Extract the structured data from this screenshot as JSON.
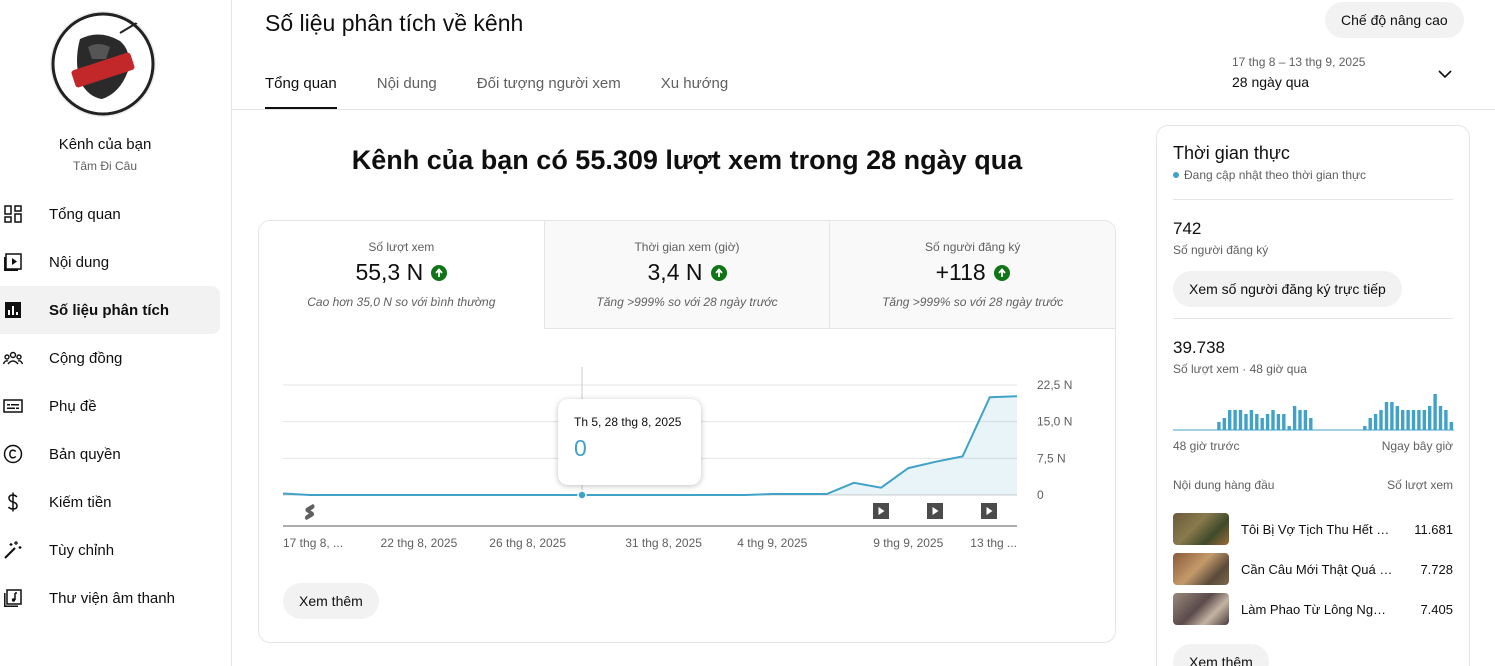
{
  "sidebar": {
    "channel_title": "Kênh của bạn",
    "channel_name": "Tâm Đi Câu",
    "items": [
      {
        "label": "Tổng quan",
        "icon": "dashboard-icon"
      },
      {
        "label": "Nội dung",
        "icon": "content-icon"
      },
      {
        "label": "Số liệu phân tích",
        "icon": "analytics-icon",
        "active": true
      },
      {
        "label": "Cộng đồng",
        "icon": "community-icon"
      },
      {
        "label": "Phụ đề",
        "icon": "subtitles-icon"
      },
      {
        "label": "Bản quyền",
        "icon": "copyright-icon"
      },
      {
        "label": "Kiếm tiền",
        "icon": "dollar-icon"
      },
      {
        "label": "Tùy chỉnh",
        "icon": "magic-wand-icon"
      },
      {
        "label": "Thư viện âm thanh",
        "icon": "audio-library-icon"
      }
    ]
  },
  "header": {
    "title": "Số liệu phân tích về kênh",
    "advanced_mode": "Chế độ nâng cao",
    "tabs": [
      "Tổng quan",
      "Nội dung",
      "Đối tượng người xem",
      "Xu hướng"
    ],
    "date_range": "17 thg 8 – 13 thg 9, 2025",
    "date_label": "28 ngày qua"
  },
  "main": {
    "headline": "Kênh của bạn có 55.309 lượt xem trong 28 ngày qua",
    "metrics": [
      {
        "label": "Số lượt xem",
        "value": "55,3 N",
        "sub": "Cao hơn 35,0 N so với bình thường"
      },
      {
        "label": "Thời gian xem (giờ)",
        "value": "3,4 N",
        "sub": "Tăng >999% so với 28 ngày trước"
      },
      {
        "label": "Số người đăng ký",
        "value": "+118",
        "sub": "Tăng >999% so với 28 ngày trước"
      }
    ],
    "tooltip": {
      "date": "Th 5, 28 thg 8, 2025",
      "value": "0"
    },
    "see_more": "Xem thêm"
  },
  "chart_data": {
    "type": "area",
    "x": [
      "17 thg 8",
      "18 thg 8",
      "19 thg 8",
      "20 thg 8",
      "21 thg 8",
      "22 thg 8",
      "23 thg 8",
      "24 thg 8",
      "25 thg 8",
      "26 thg 8",
      "27 thg 8",
      "28 thg 8",
      "29 thg 8",
      "30 thg 8",
      "31 thg 8",
      "1 thg 9",
      "2 thg 9",
      "3 thg 9",
      "4 thg 9",
      "5 thg 9",
      "6 thg 9",
      "7 thg 9",
      "8 thg 9",
      "9 thg 9",
      "10 thg 9",
      "11 thg 9",
      "12 thg 9",
      "13 thg 9"
    ],
    "values": [
      300,
      0,
      0,
      0,
      0,
      0,
      0,
      0,
      0,
      0,
      0,
      0,
      0,
      0,
      0,
      0,
      0,
      0,
      200,
      200,
      200,
      2500,
      1500,
      5500,
      6800,
      7900,
      20000,
      20200
    ],
    "x_tick_labels": [
      "17 thg 8, ...",
      "22 thg 8, 2025",
      "26 thg 8, 2025",
      "31 thg 8, 2025",
      "4 thg 9, 2025",
      "9 thg 9, 2025",
      "13 thg ..."
    ],
    "y_tick_labels": [
      "22,5 N",
      "15,0 N",
      "7,5 N",
      "0"
    ],
    "ylim": [
      0,
      22500
    ],
    "line_color": "#41a2c7"
  },
  "realtime": {
    "title": "Thời gian thực",
    "live_label": "Đang cập nhật theo thời gian thực",
    "subs_value": "742",
    "subs_caption": "Số người đăng ký",
    "subs_button": "Xem số người đăng ký trực tiếp",
    "views_value": "39.738",
    "views_caption": "Số lượt xem · 48 giờ qua",
    "spark_left": "48 giờ trước",
    "spark_right": "Ngay bây giờ",
    "spark_values": [
      0,
      0,
      0,
      0,
      0,
      0,
      0,
      0,
      2,
      3,
      5,
      5,
      5,
      4,
      5,
      4,
      3,
      4,
      5,
      4,
      4,
      1,
      6,
      5,
      5,
      3,
      0,
      0,
      0,
      0,
      0,
      0,
      0,
      0,
      0,
      1,
      3,
      4,
      5,
      7,
      7,
      6,
      5,
      5,
      5,
      5,
      5,
      6,
      9,
      6,
      5,
      2
    ],
    "top_header_left": "Nội dung hàng đầu",
    "top_header_right": "Số lượt xem",
    "top_items": [
      {
        "title": "Tôi Bị Vợ Tịch Thu Hết Cần Câu",
        "views": "11.681"
      },
      {
        "title": "Cần Câu Mới Thật Quá Đỉnh",
        "views": "7.728"
      },
      {
        "title": "Làm Phao Từ Lông Ngỗng",
        "views": "7.405"
      }
    ],
    "see_more": "Xem thêm"
  }
}
